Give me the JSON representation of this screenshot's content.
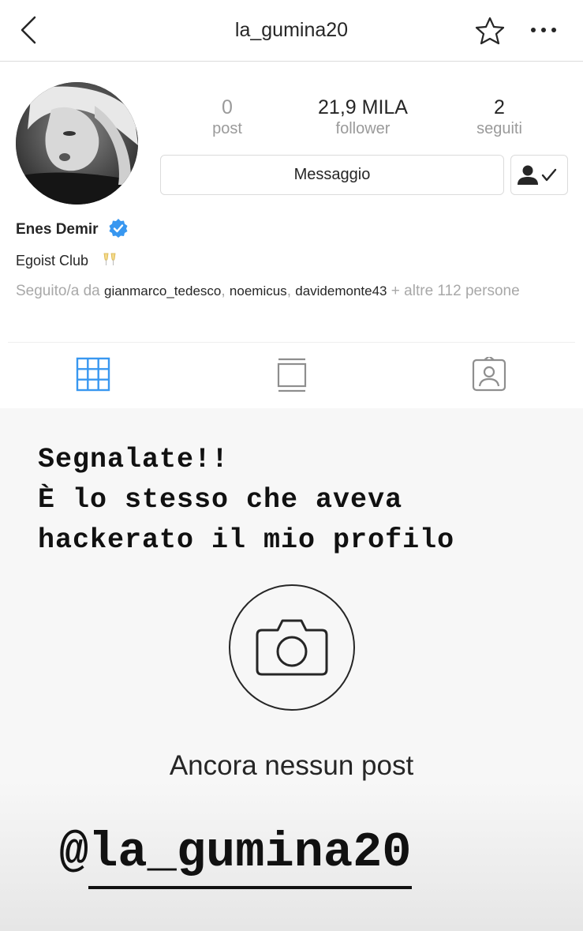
{
  "header": {
    "username": "la_gumina20"
  },
  "profile": {
    "stats": [
      {
        "value": "0",
        "label": "post"
      },
      {
        "value": "21,9 MILA",
        "label": "follower"
      },
      {
        "value": "2",
        "label": "seguiti"
      }
    ],
    "message_button": "Messaggio",
    "name": "Enes Demir",
    "bio": "Egoist Club",
    "followed_by": {
      "prefix": "Seguito/a da",
      "users": [
        "gianmarco_tedesco",
        "noemicus",
        "davidemonte43"
      ],
      "suffix": "+ altre 112 persone"
    }
  },
  "empty_state": {
    "text": "Ancora nessun post"
  },
  "story_overlay": {
    "lines": [
      "Segnalate!!",
      "È lo stesso che aveva",
      "hackerato il mio profilo"
    ],
    "handle_at": "@",
    "handle_name": "la_gumina20"
  },
  "colors": {
    "accent_blue": "#3897f0",
    "text": "#262626",
    "muted": "#9a9a9a",
    "border": "#dbdbdb"
  },
  "icons": {
    "back": "chevron-left-icon",
    "favorite": "star-icon",
    "options": "more-icon",
    "verified": "verified-badge-icon",
    "following": "person-check-icon",
    "grid_tab": "grid-icon",
    "feed_tab": "feed-icon",
    "tagged_tab": "tagged-icon",
    "empty_camera": "camera-icon"
  }
}
